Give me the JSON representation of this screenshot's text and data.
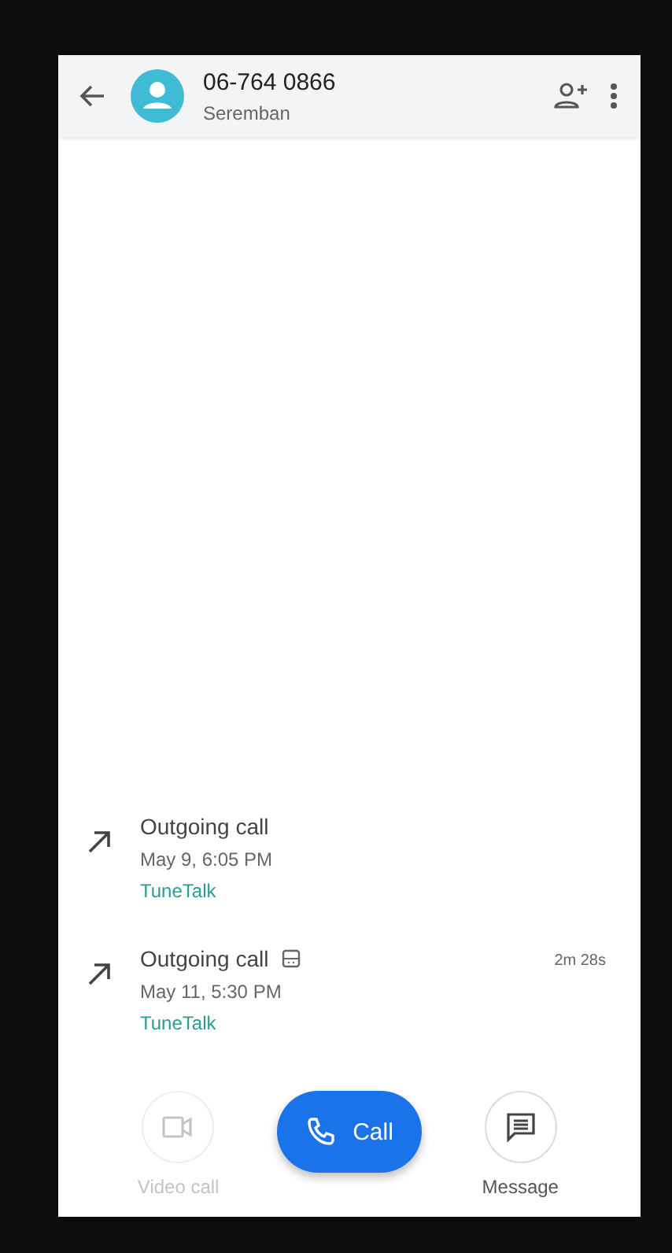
{
  "header": {
    "title": "06-764 0866",
    "subtitle": "Seremban"
  },
  "calls": [
    {
      "type": "Outgoing call",
      "time": "May 9, 6:05 PM",
      "carrier": "TuneTalk",
      "recorded": false
    },
    {
      "type": "Outgoing call",
      "time": "May 11, 5:30 PM",
      "carrier": "TuneTalk",
      "recorded": true,
      "duration": "2m 28s"
    }
  ],
  "actions": [
    {
      "kind": "video",
      "label": "Video call",
      "disabled": true
    },
    {
      "kind": "call",
      "label": "Call",
      "disabled": false
    },
    {
      "kind": "message",
      "label": "Message",
      "disabled": false
    }
  ]
}
